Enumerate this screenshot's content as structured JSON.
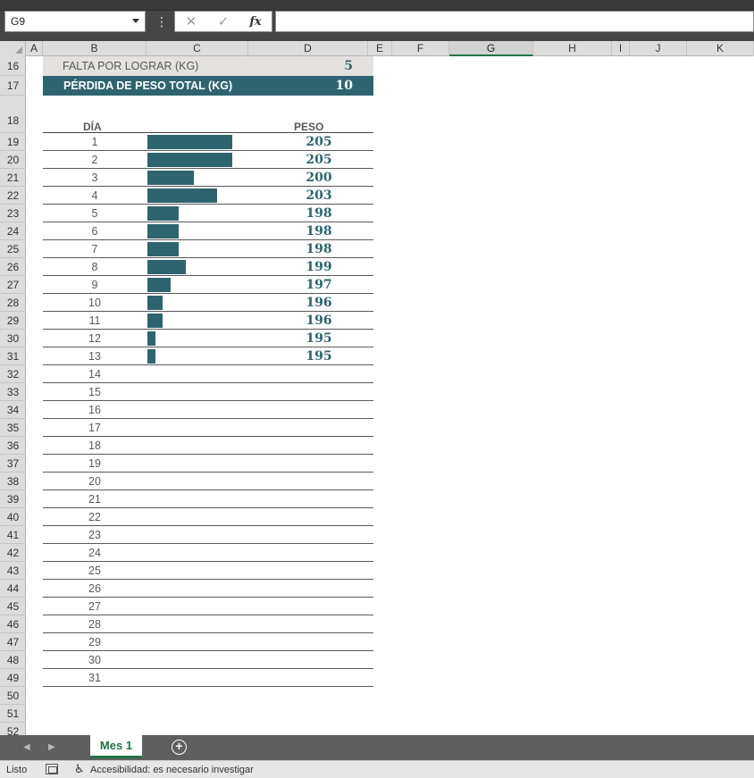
{
  "formula_bar": {
    "name_box": "G9",
    "cancel_icon": "✕",
    "enter_icon": "✓",
    "fx_icon": "fx",
    "formula_value": ""
  },
  "columns": [
    {
      "label": "A",
      "selected": false
    },
    {
      "label": "B",
      "selected": false
    },
    {
      "label": "C",
      "selected": false
    },
    {
      "label": "D",
      "selected": false
    },
    {
      "label": "E",
      "selected": false
    },
    {
      "label": "F",
      "selected": false
    },
    {
      "label": "G",
      "selected": true
    },
    {
      "label": "H",
      "selected": false
    },
    {
      "label": "I",
      "selected": false
    },
    {
      "label": "J",
      "selected": false
    },
    {
      "label": "K",
      "selected": false
    }
  ],
  "row_numbers": [
    "16",
    "17",
    "18",
    "19",
    "20",
    "21",
    "22",
    "23",
    "24",
    "25",
    "26",
    "27",
    "28",
    "29",
    "30",
    "31",
    "32",
    "33",
    "34",
    "35",
    "36",
    "37",
    "38",
    "39",
    "40",
    "41",
    "42",
    "43",
    "44",
    "45",
    "46",
    "47",
    "48",
    "49",
    "50",
    "51",
    "52"
  ],
  "summary": {
    "remaining_label": "FALTA POR LOGRAR (KG)",
    "remaining_value": "5",
    "total_label": "PÉRDIDA DE PESO TOTAL (KG)",
    "total_value": "10"
  },
  "table": {
    "day_header": "DÍA",
    "weight_header": "PESO",
    "rows": [
      {
        "day": "1",
        "weight": "205",
        "bar": 205
      },
      {
        "day": "2",
        "weight": "205",
        "bar": 205
      },
      {
        "day": "3",
        "weight": "200",
        "bar": 200
      },
      {
        "day": "4",
        "weight": "203",
        "bar": 203
      },
      {
        "day": "5",
        "weight": "198",
        "bar": 198
      },
      {
        "day": "6",
        "weight": "198",
        "bar": 198
      },
      {
        "day": "7",
        "weight": "198",
        "bar": 198
      },
      {
        "day": "8",
        "weight": "199",
        "bar": 199
      },
      {
        "day": "9",
        "weight": "197",
        "bar": 197
      },
      {
        "day": "10",
        "weight": "196",
        "bar": 196
      },
      {
        "day": "11",
        "weight": "196",
        "bar": 196
      },
      {
        "day": "12",
        "weight": "195",
        "bar": 195
      },
      {
        "day": "13",
        "weight": "195",
        "bar": 195
      },
      {
        "day": "14",
        "weight": "",
        "bar": null
      },
      {
        "day": "15",
        "weight": "",
        "bar": null
      },
      {
        "day": "16",
        "weight": "",
        "bar": null
      },
      {
        "day": "17",
        "weight": "",
        "bar": null
      },
      {
        "day": "18",
        "weight": "",
        "bar": null
      },
      {
        "day": "19",
        "weight": "",
        "bar": null
      },
      {
        "day": "20",
        "weight": "",
        "bar": null
      },
      {
        "day": "21",
        "weight": "",
        "bar": null
      },
      {
        "day": "22",
        "weight": "",
        "bar": null
      },
      {
        "day": "23",
        "weight": "",
        "bar": null
      },
      {
        "day": "24",
        "weight": "",
        "bar": null
      },
      {
        "day": "25",
        "weight": "",
        "bar": null
      },
      {
        "day": "26",
        "weight": "",
        "bar": null
      },
      {
        "day": "27",
        "weight": "",
        "bar": null
      },
      {
        "day": "28",
        "weight": "",
        "bar": null
      },
      {
        "day": "29",
        "weight": "",
        "bar": null
      },
      {
        "day": "30",
        "weight": "",
        "bar": null
      },
      {
        "day": "31",
        "weight": "",
        "bar": null
      }
    ],
    "databar_min": 194,
    "databar_max": 205,
    "databar_color": "#2e6470"
  },
  "tabs": {
    "prev_icon": "◀",
    "next_icon": "▶",
    "sheet_name": "Mes 1",
    "add_icon": "+"
  },
  "status": {
    "ready": "Listo",
    "accessibility": "Accesibilidad: es necesario investigar"
  },
  "colors": {
    "accent_green": "#217346",
    "teal": "#2e6470",
    "summary_bg": "#e4e2de"
  }
}
